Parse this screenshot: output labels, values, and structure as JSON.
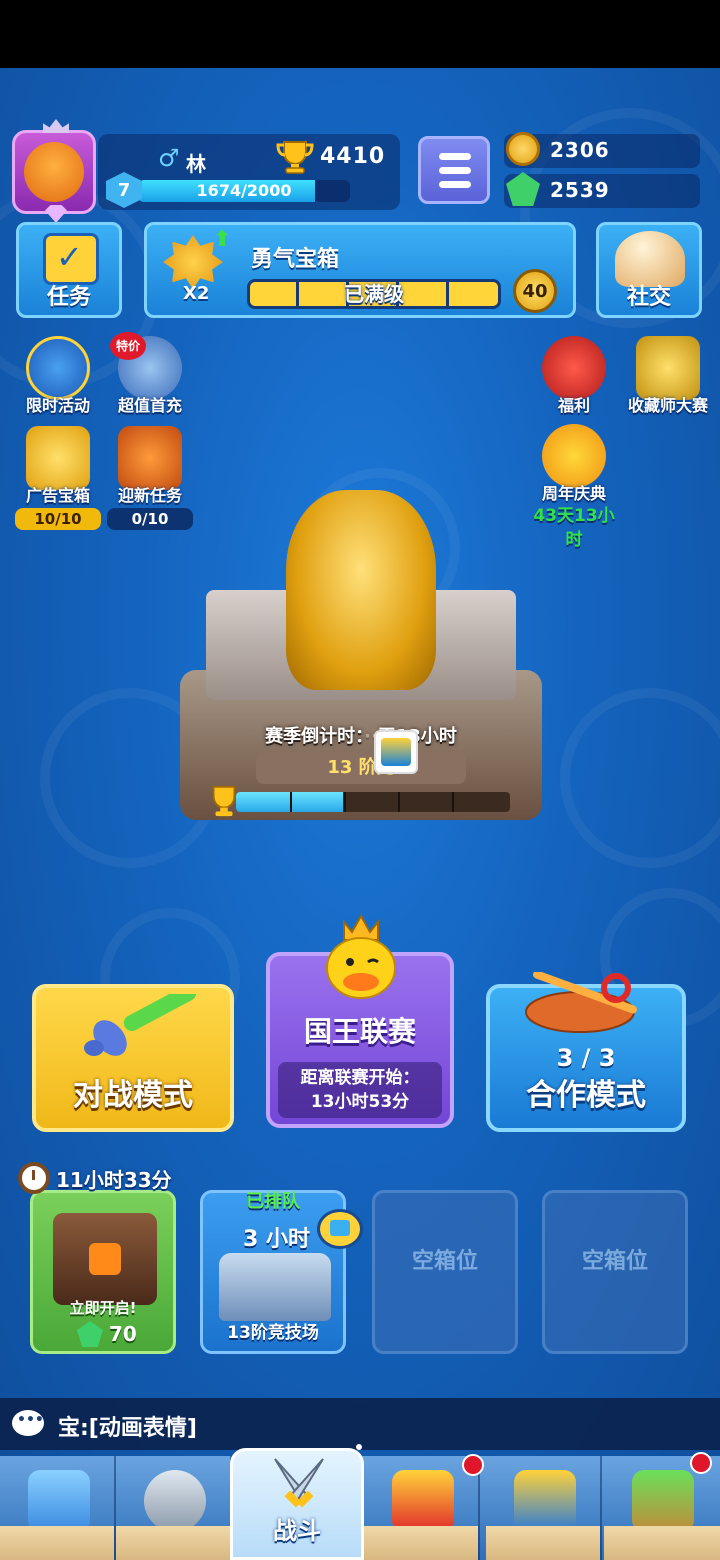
{
  "player": {
    "gender_symbol": "♂",
    "name": "林",
    "trophies": "4410",
    "level": "7",
    "xp_text": "1674/2000",
    "xp_fraction": 0.837
  },
  "currency": {
    "coins": "2306",
    "gems": "2539"
  },
  "top_buttons": {
    "task_label": "任务",
    "social_label": "社交"
  },
  "courage_chest": {
    "title": "勇气宝箱",
    "multiplier": "X2",
    "status": "已满级",
    "level": "40"
  },
  "side_left": [
    {
      "label": "限时活动"
    },
    {
      "label": "超值首充",
      "tag": "特价"
    },
    {
      "label": "广告宝箱",
      "counter": "10/10"
    },
    {
      "label": "迎新任务",
      "counter": "0/10"
    }
  ],
  "side_right": [
    {
      "label": "福利"
    },
    {
      "label": "收藏师大赛"
    },
    {
      "label": "周年庆典",
      "timer_line1": "43天13小",
      "timer_line2": "时"
    }
  ],
  "arena": {
    "season_countdown": "赛季倒计时：",
    "season_countdown_tail": "天13小时",
    "arena_name": "13 阶竞",
    "progress_fraction": 0.39
  },
  "modes": {
    "battle": "对战模式",
    "league_title": "国王联赛",
    "league_info_line1": "距离联赛开始：",
    "league_info_line2": "13小时53分",
    "coop_count": "3 / 3",
    "coop": "合作模式"
  },
  "chest_slots": {
    "timer": "11小时33分",
    "open_now": "立即开启!",
    "open_cost": "70",
    "queued": "已排队",
    "queue_time": "3 小时",
    "slot2_name": "13阶竞技场",
    "empty_label": "空箱位"
  },
  "chat": {
    "text": "宝:[动画表情]"
  },
  "nav": {
    "active_label": "战斗"
  },
  "colors": {
    "background": "#1463bd",
    "battle_yellow": "#f0b818",
    "league_purple": "#7446d6",
    "coop_blue": "#1a7ad4",
    "gem_green": "#3fd06a",
    "timer_green": "#33e04a"
  }
}
